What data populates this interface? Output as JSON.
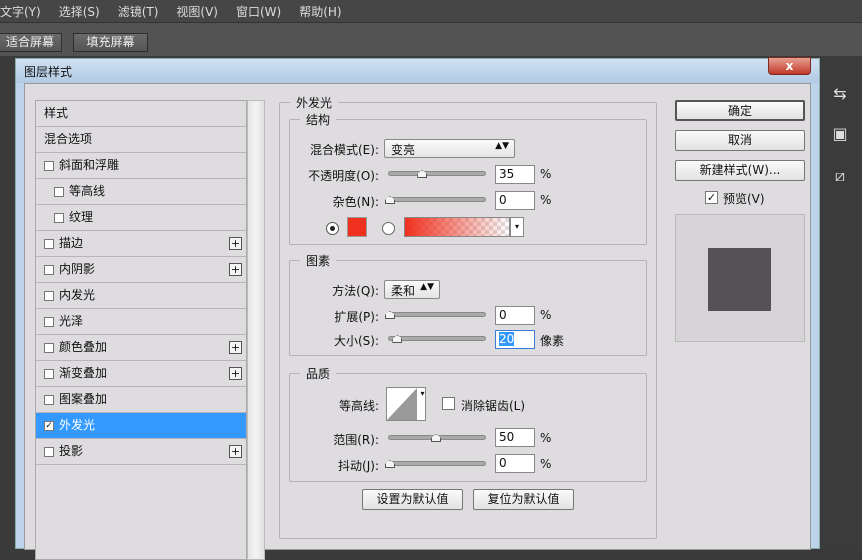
{
  "menubar": [
    "文字(Y)",
    "选择(S)",
    "滤镜(T)",
    "视图(V)",
    "窗口(W)",
    "帮助(H)"
  ],
  "toolbar": {
    "fit_screen": "适合屏幕",
    "fill_screen": "填充屏幕"
  },
  "dialog": {
    "title": "图层样式",
    "close": "x"
  },
  "style_list": [
    {
      "label": "样式",
      "checkbox": false,
      "checked": false,
      "indent": false,
      "plus": false,
      "selected": false
    },
    {
      "label": "混合选项",
      "checkbox": false,
      "checked": false,
      "indent": false,
      "plus": false,
      "selected": false
    },
    {
      "label": "斜面和浮雕",
      "checkbox": true,
      "checked": false,
      "indent": false,
      "plus": false,
      "selected": false
    },
    {
      "label": "等高线",
      "checkbox": true,
      "checked": false,
      "indent": true,
      "plus": false,
      "selected": false
    },
    {
      "label": "纹理",
      "checkbox": true,
      "checked": false,
      "indent": true,
      "plus": false,
      "selected": false
    },
    {
      "label": "描边",
      "checkbox": true,
      "checked": false,
      "indent": false,
      "plus": true,
      "selected": false
    },
    {
      "label": "内阴影",
      "checkbox": true,
      "checked": false,
      "indent": false,
      "plus": true,
      "selected": false
    },
    {
      "label": "内发光",
      "checkbox": true,
      "checked": false,
      "indent": false,
      "plus": false,
      "selected": false
    },
    {
      "label": "光泽",
      "checkbox": true,
      "checked": false,
      "indent": false,
      "plus": false,
      "selected": false
    },
    {
      "label": "颜色叠加",
      "checkbox": true,
      "checked": false,
      "indent": false,
      "plus": true,
      "selected": false
    },
    {
      "label": "渐变叠加",
      "checkbox": true,
      "checked": false,
      "indent": false,
      "plus": true,
      "selected": false
    },
    {
      "label": "图案叠加",
      "checkbox": true,
      "checked": false,
      "indent": false,
      "plus": false,
      "selected": false
    },
    {
      "label": "外发光",
      "checkbox": true,
      "checked": true,
      "indent": false,
      "plus": false,
      "selected": true
    },
    {
      "label": "投影",
      "checkbox": true,
      "checked": false,
      "indent": false,
      "plus": true,
      "selected": false
    }
  ],
  "outer_glow": {
    "title": "外发光",
    "structure": {
      "title": "结构",
      "blend_mode_label": "混合模式(E):",
      "blend_mode": "变亮",
      "opacity_label": "不透明度(O):",
      "opacity": "35",
      "opacity_value": 35,
      "noise_label": "杂色(N):",
      "noise": "0",
      "noise_value": 0,
      "pct": "%",
      "color": "#f0301e"
    },
    "elements": {
      "title": "图素",
      "technique_label": "方法(Q):",
      "technique": "柔和",
      "spread_label": "扩展(P):",
      "spread": "0",
      "spread_value": 0,
      "size_label": "大小(S):",
      "size": "20",
      "size_value": 20,
      "size_unit": "像素",
      "pct": "%"
    },
    "quality": {
      "title": "品质",
      "contour_label": "等高线:",
      "antialias_label": "消除锯齿(L)",
      "antialias": false,
      "range_label": "范围(R):",
      "range": "50",
      "range_value": 50,
      "jitter_label": "抖动(J):",
      "jitter": "0",
      "jitter_value": 0,
      "pct": "%"
    },
    "set_default": "设置为默认值",
    "reset_default": "复位为默认值"
  },
  "buttons": {
    "ok": "确定",
    "cancel": "取消",
    "new_style": "新建样式(W)...",
    "preview_label": "预览(V)",
    "preview": true
  }
}
